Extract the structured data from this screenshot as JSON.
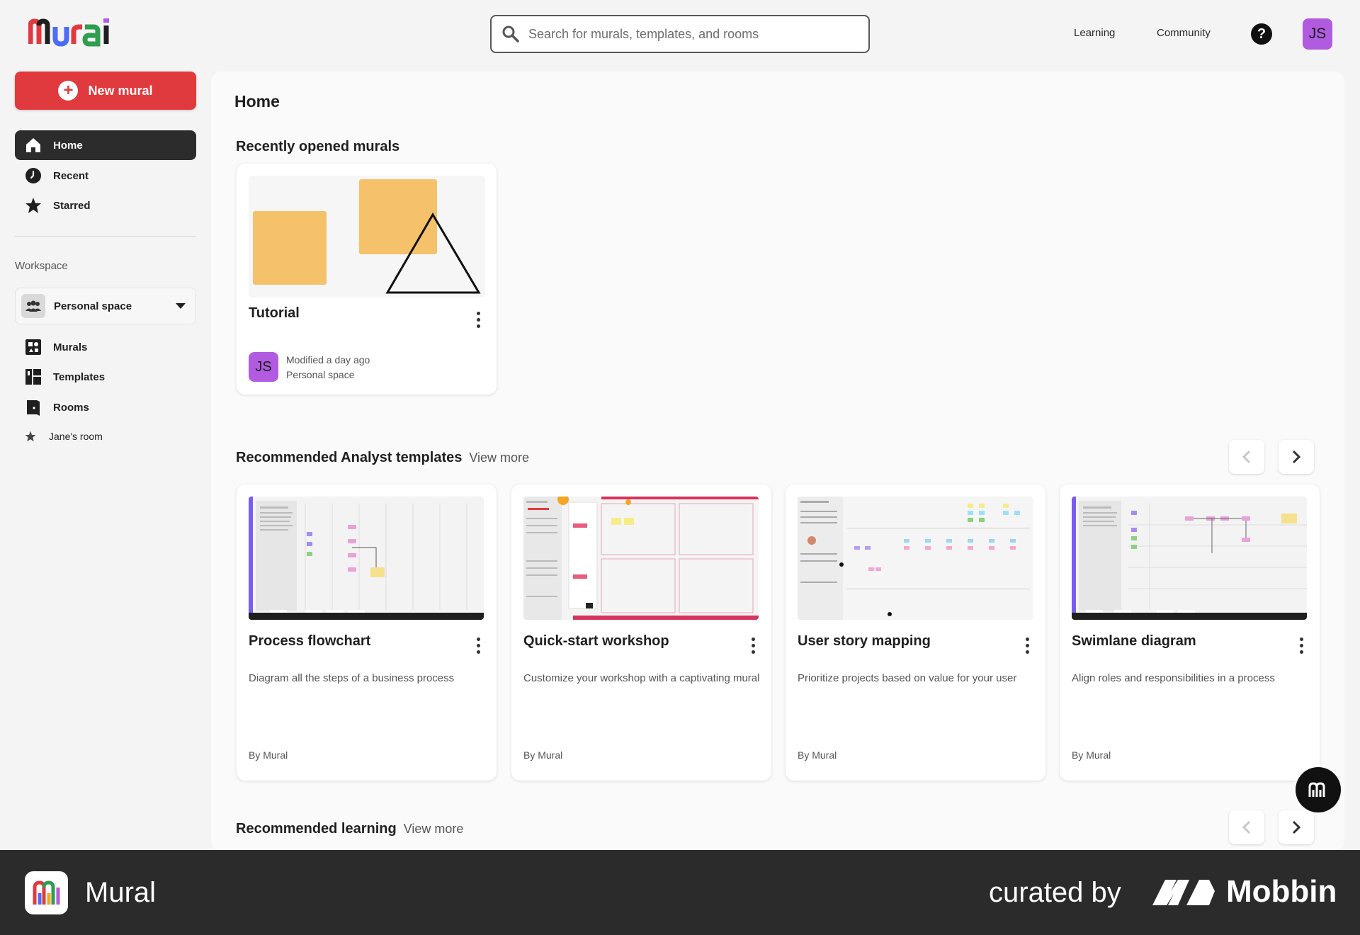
{
  "header": {
    "logo_alt": "Mural",
    "search": {
      "placeholder": "Search for murals, templates, and rooms",
      "value": ""
    },
    "links": [
      "Learning",
      "Community"
    ],
    "help_glyph": "?",
    "user_initials": "JS",
    "avatar_color": "#b05be0"
  },
  "sidebar": {
    "new_mural_label": "New mural",
    "nav": [
      {
        "label": "Home",
        "icon": "home-icon",
        "active": true
      },
      {
        "label": "Recent",
        "icon": "clock-icon"
      },
      {
        "label": "Starred",
        "icon": "star-icon"
      }
    ],
    "workspace_label": "Workspace",
    "workspace_select": "Personal space",
    "workspace_nav": [
      {
        "label": "Murals",
        "icon": "murals-icon"
      },
      {
        "label": "Templates",
        "icon": "templates-icon"
      },
      {
        "label": "Rooms",
        "icon": "rooms-icon"
      }
    ],
    "rooms": [
      {
        "label": "Jane's room",
        "icon": "star-small-icon"
      }
    ]
  },
  "main": {
    "page_title": "Home",
    "recent_section_title": "Recently opened murals",
    "recent_murals": [
      {
        "title": "Tutorial",
        "modified": "Modified a day ago",
        "space": "Personal space",
        "owner_initials": "JS"
      }
    ],
    "templates_section_title": "Recommended Analyst templates",
    "view_more": "View more",
    "templates": [
      {
        "title": "Process flowchart",
        "description": "Diagram all the steps of a business process",
        "by": "By Mural"
      },
      {
        "title": "Quick-start workshop",
        "description": "Customize your workshop with a captivating mural",
        "by": "By Mural"
      },
      {
        "title": "User story mapping",
        "description": "Prioritize projects based on value for your user",
        "by": "By Mural"
      },
      {
        "title": "Swimlane diagram",
        "description": "Align roles and responsibilities in a process",
        "by": "By Mural"
      }
    ],
    "learning_section_title": "Recommended learning"
  },
  "colors": {
    "accent": "#e03a3e",
    "sticky": "#f5c26b",
    "dark": "#2c2c2c"
  },
  "footer": {
    "app_name": "Mural",
    "curated_by": "curated by",
    "brand": "Mobbin"
  }
}
